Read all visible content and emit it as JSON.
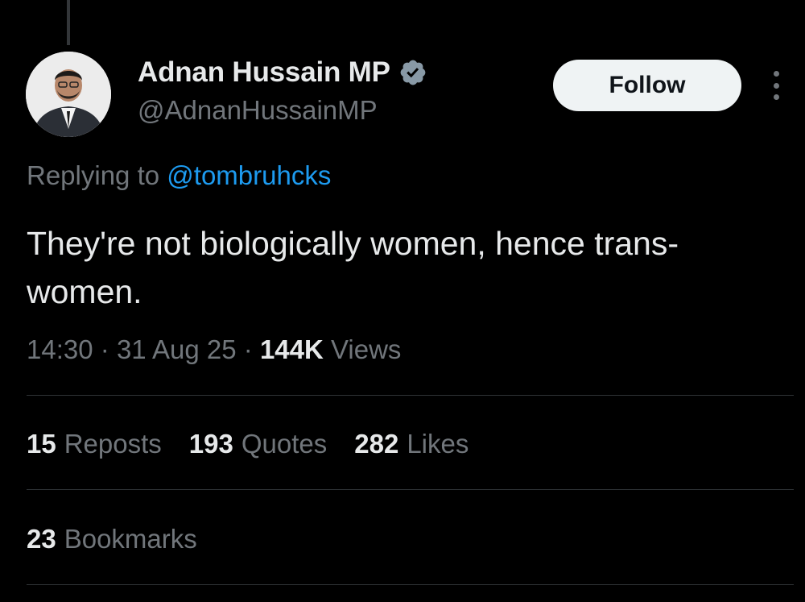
{
  "author": {
    "display_name": "Adnan Hussain MP",
    "handle": "@AdnanHussainMP",
    "verified": true,
    "verified_color": "#8899a6"
  },
  "follow_label": "Follow",
  "reply": {
    "prefix": "Replying to",
    "mention": "@tombruhcks"
  },
  "tweet": {
    "text": "They're not biologically women, hence trans-women."
  },
  "meta": {
    "time": "14:30",
    "date": "31 Aug 25",
    "views_count": "144K",
    "views_label": "Views"
  },
  "stats": {
    "reposts_count": "15",
    "reposts_label": "Reposts",
    "quotes_count": "193",
    "quotes_label": "Quotes",
    "likes_count": "282",
    "likes_label": "Likes",
    "bookmarks_count": "23",
    "bookmarks_label": "Bookmarks"
  },
  "colors": {
    "background": "#000000",
    "text_primary": "#e7e9ea",
    "text_secondary": "#71767b",
    "link": "#1d9bf0",
    "divider": "#2f3336"
  }
}
